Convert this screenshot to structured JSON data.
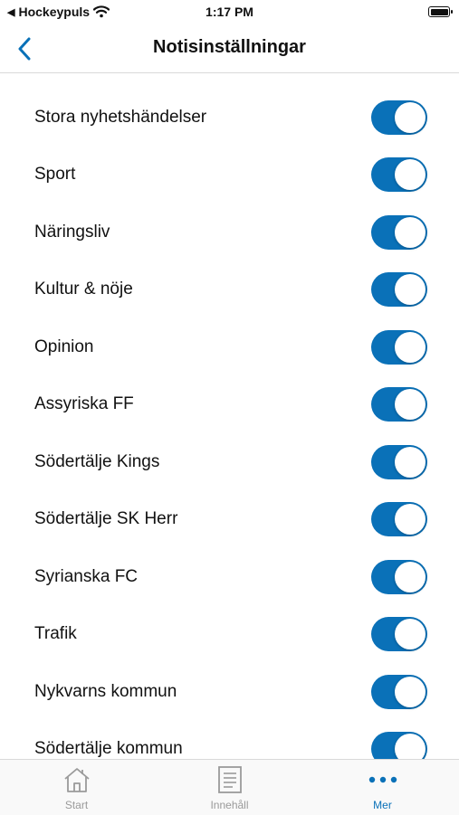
{
  "status_bar": {
    "carrier": "Hockeypuls",
    "time": "1:17 PM"
  },
  "nav": {
    "title": "Notisinställningar",
    "back_icon": "chevron-left-icon"
  },
  "settings": [
    {
      "label": "Stora nyhetshändelser",
      "enabled": true
    },
    {
      "label": "Sport",
      "enabled": true
    },
    {
      "label": "Näringsliv",
      "enabled": true
    },
    {
      "label": "Kultur & nöje",
      "enabled": true
    },
    {
      "label": "Opinion",
      "enabled": true
    },
    {
      "label": "Assyriska FF",
      "enabled": true
    },
    {
      "label": "Södertälje Kings",
      "enabled": true
    },
    {
      "label": "Södertälje SK Herr",
      "enabled": true
    },
    {
      "label": "Syrianska FC",
      "enabled": true
    },
    {
      "label": "Trafik",
      "enabled": true
    },
    {
      "label": "Nykvarns kommun",
      "enabled": true
    },
    {
      "label": "Södertälje kommun",
      "enabled": true
    }
  ],
  "tabs": [
    {
      "label": "Start",
      "icon": "home-icon",
      "active": false
    },
    {
      "label": "Innehåll",
      "icon": "document-icon",
      "active": false
    },
    {
      "label": "Mer",
      "icon": "more-icon",
      "active": true
    }
  ],
  "colors": {
    "accent": "#0a71b8",
    "inactive_tab": "#9a9a9a"
  }
}
